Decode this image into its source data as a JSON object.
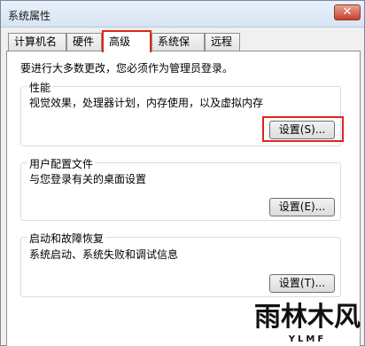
{
  "window": {
    "title": "系统属性",
    "close_glyph": "✕"
  },
  "tabs": [
    {
      "label": "计算机名"
    },
    {
      "label": "硬件"
    },
    {
      "label": "高级"
    },
    {
      "label": "系统保护"
    },
    {
      "label": "远程"
    }
  ],
  "intro": "要进行大多数更改，您必须作为管理员登录。",
  "groups": [
    {
      "title": "性能",
      "desc": "视觉效果，处理器计划，内存使用，以及虚拟内存",
      "button": "设置(S)..."
    },
    {
      "title": "用户配置文件",
      "desc": "与您登录有关的桌面设置",
      "button": "设置(E)..."
    },
    {
      "title": "启动和故障恢复",
      "desc": "系统启动、系统失败和调试信息",
      "button": "设置(T)..."
    }
  ],
  "watermark": {
    "main": "雨林木风",
    "sub": "YLMF"
  },
  "colors": {
    "highlight": "#e0251b",
    "tab_active_bg": "#ffffff"
  }
}
